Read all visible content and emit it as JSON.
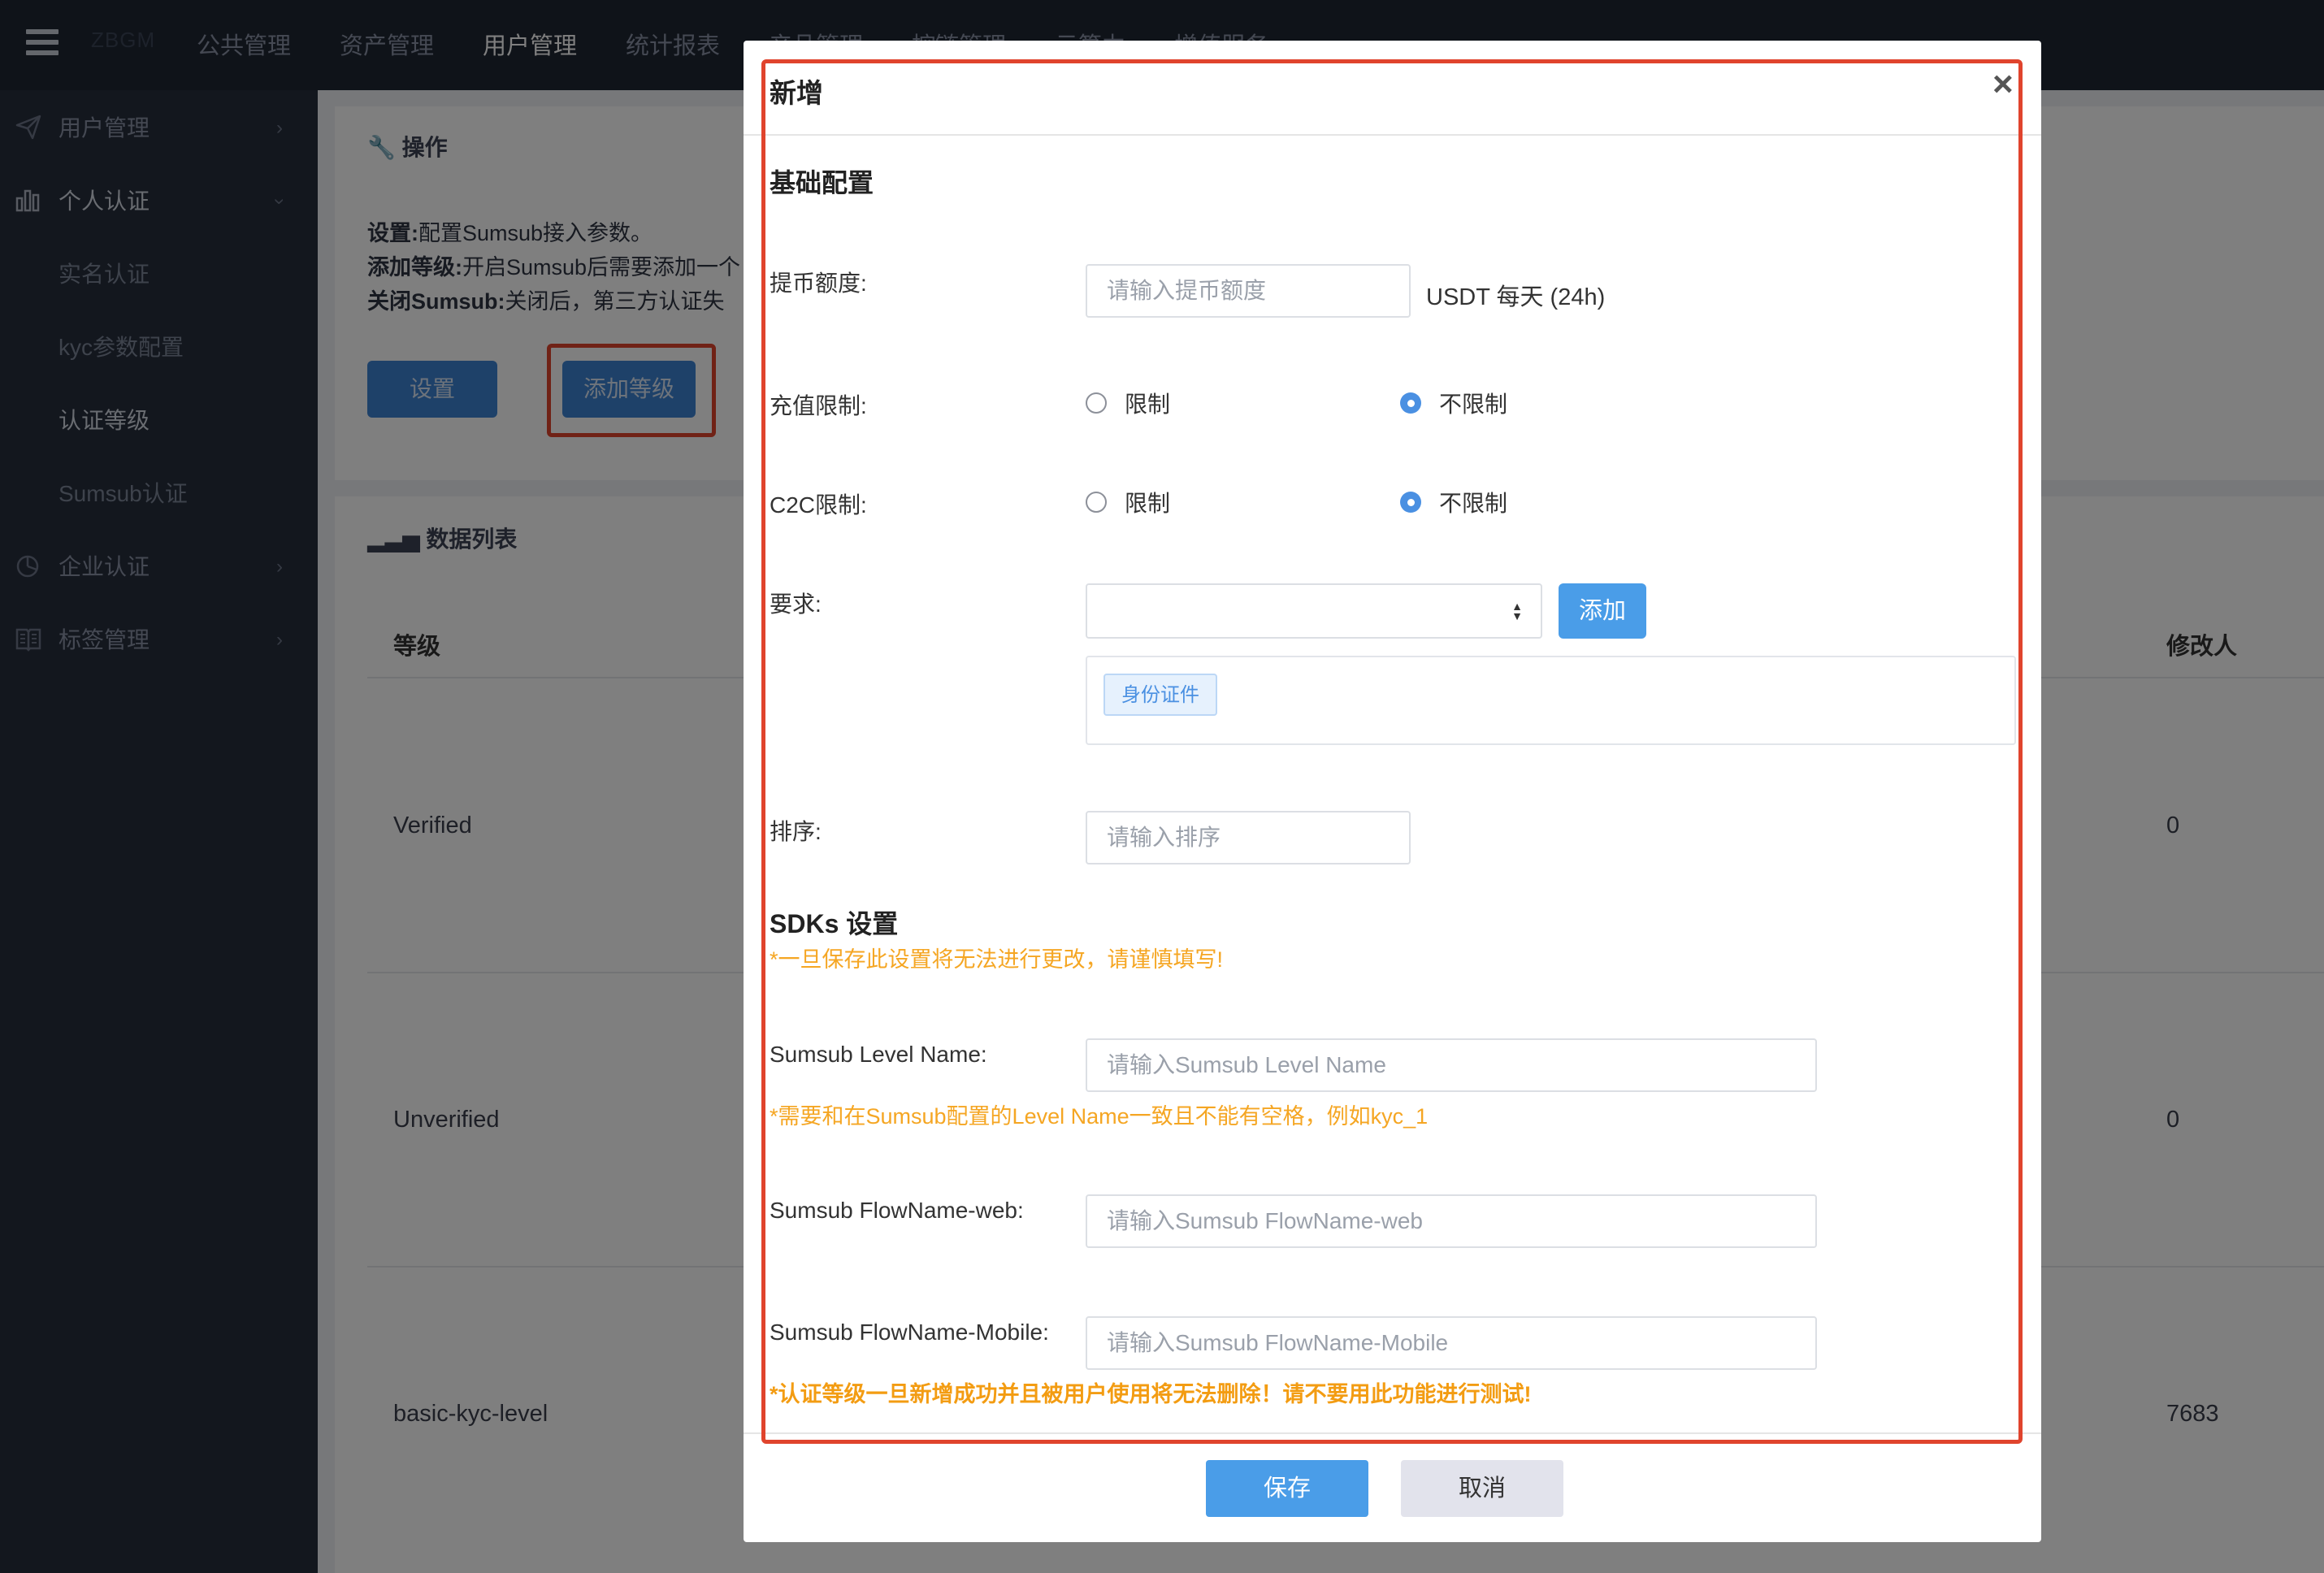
{
  "topbar": {
    "brand": "ZBGM",
    "nav": [
      "公共管理",
      "资产管理",
      "用户管理",
      "统计报表",
      "产品管理",
      "控链管理",
      "云算力",
      "增值服务"
    ],
    "active_index": 2
  },
  "sidebar": {
    "items": [
      {
        "label": "用户管理",
        "icon": "paper-plane-icon"
      },
      {
        "label": "个人认证",
        "icon": "bar-chart-icon"
      },
      {
        "label": "实名认证"
      },
      {
        "label": "kyc参数配置"
      },
      {
        "label": "认证等级"
      },
      {
        "label": "Sumsub认证"
      },
      {
        "label": "企业认证",
        "icon": "pie-chart-icon"
      },
      {
        "label": "标签管理",
        "icon": "book-icon"
      }
    ]
  },
  "ops_panel": {
    "title": "操作",
    "lines": [
      {
        "key": "设置:",
        "text": "配置Sumsub接入参数。"
      },
      {
        "key": "添加等级:",
        "text": "开启Sumsub后需要添加一个"
      },
      {
        "key": "关闭Sumsub:",
        "text": "关闭后，第三方认证失"
      }
    ],
    "settings_button": "设置",
    "add_level_button": "添加等级"
  },
  "data_panel": {
    "title": "数据列表",
    "columns": [
      "等级",
      "修改人"
    ],
    "rows": [
      {
        "level": "Verified",
        "modifier": "0"
      },
      {
        "level": "Unverified",
        "modifier": "0"
      },
      {
        "level": "basic-kyc-level",
        "modifier": "7683"
      }
    ]
  },
  "modal": {
    "title": "新增",
    "close": "×",
    "section_basic": "基础配置",
    "withdraw_label": "提币额度:",
    "withdraw_placeholder": "请输入提币额度",
    "withdraw_unit": "USDT 每天 (24h)",
    "deposit_label": "充值限制:",
    "c2c_label": "C2C限制:",
    "option_limit": "限制",
    "option_unlimited": "不限制",
    "deposit_value": "不限制",
    "c2c_value": "不限制",
    "requirement_label": "要求:",
    "requirement_select": "",
    "add_button": "添加",
    "requirement_tags": [
      "身份证件"
    ],
    "sort_label": "排序:",
    "sort_placeholder": "请输入排序",
    "section_sdk": "SDKs 设置",
    "sdk_warning": "*一旦保存此设置将无法进行更改，请谨慎填写!",
    "level_name_label": "Sumsub Level Name:",
    "level_name_placeholder": "请输入Sumsub Level Name",
    "level_name_hint": "*需要和在Sumsub配置的Level Name一致且不能有空格，例如kyc_1",
    "flow_web_label": "Sumsub FlowName-web:",
    "flow_web_placeholder": "请输入Sumsub FlowName-web",
    "flow_mobile_label": "Sumsub FlowName-Mobile:",
    "flow_mobile_placeholder": "请输入Sumsub FlowName-Mobile",
    "final_warning": "*认证等级一旦新增成功并且被用户使用将无法删除！请不要用此功能进行测试!",
    "save_button": "保存",
    "cancel_button": "取消"
  },
  "colors": {
    "topbar": "#1f2633",
    "sidebar": "#262e3d",
    "primary": "#4a9de8",
    "highlight": "#e0442d",
    "warning": "#f5a623"
  }
}
